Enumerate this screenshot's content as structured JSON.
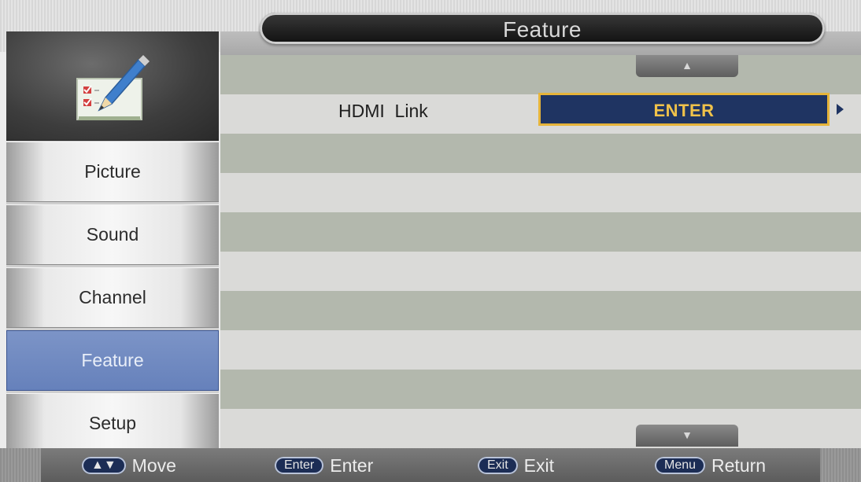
{
  "header": {
    "title": "Feature"
  },
  "sidebar": {
    "items": [
      {
        "label": "Picture"
      },
      {
        "label": "Sound"
      },
      {
        "label": "Channel"
      },
      {
        "label": "Feature",
        "active": true
      },
      {
        "label": "Setup"
      }
    ]
  },
  "main": {
    "rows": [
      {
        "label": "HDMI  Link",
        "value": "ENTER"
      }
    ]
  },
  "footer": {
    "hints": [
      {
        "key": "▲▼",
        "action": "Move"
      },
      {
        "key": "Enter",
        "action": "Enter"
      },
      {
        "key": "Exit",
        "action": "Exit"
      },
      {
        "key": "Menu",
        "action": "Return"
      }
    ]
  },
  "colors": {
    "active_item": "#6f88bf",
    "selection_box": "#1f3462",
    "selection_border": "#e6b43a",
    "selection_text": "#f0c24a"
  }
}
